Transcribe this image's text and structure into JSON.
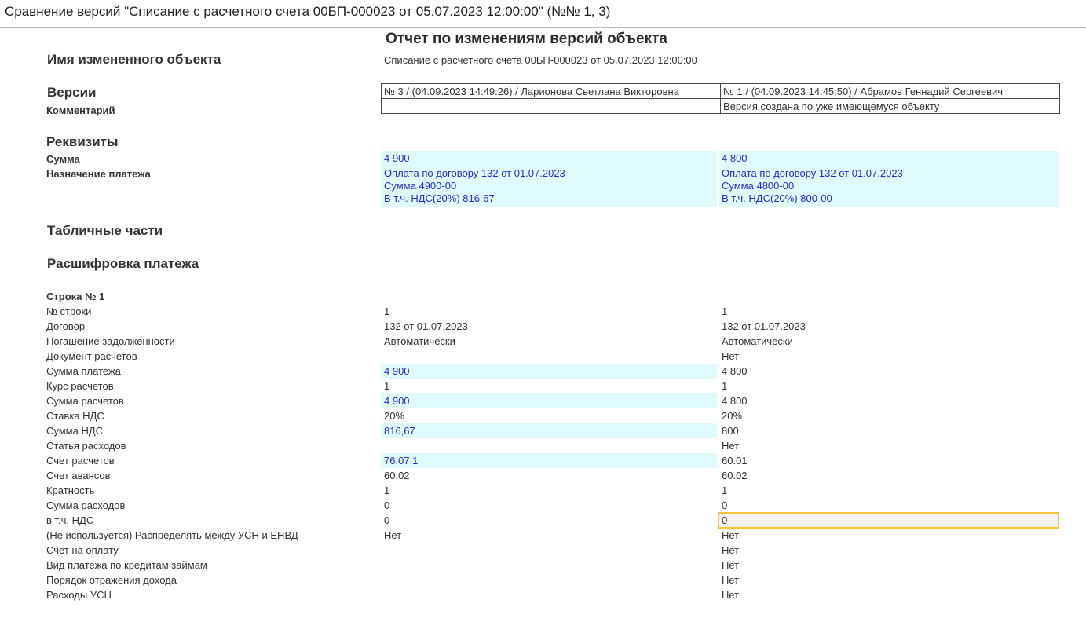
{
  "window": {
    "title": "Сравнение версий \"Списание с расчетного счета 00БП-000023 от 05.07.2023 12:00:00\" (№№ 1, 3)"
  },
  "report": {
    "title": "Отчет по изменениям версий объекта",
    "object_heading": "Имя измененного объекта",
    "object_name": "Списание с расчетного счета 00БП-000023 от 05.07.2023 12:00:00",
    "versions_heading": "Версии",
    "comment_label": "Комментарий",
    "versions": [
      {
        "header": "№ 3 / (04.09.2023 14:49:26) / Ларионова Светлана Викторовна",
        "comment": ""
      },
      {
        "header": "№ 1 / (04.09.2023 14:45:50) / Абрамов Геннадий Сергеевич",
        "comment": "Версия создана по уже имеющемуся объекту"
      }
    ],
    "attributes_heading": "Реквизиты",
    "attributes": {
      "sum_label": "Сумма",
      "sum_values": [
        "4 900",
        "4 800"
      ],
      "purpose_label": "Назначение платежа",
      "purpose_values": [
        [
          "Оплата по договору 132 от 01.07.2023",
          "Сумма 4900-00",
          "В т.ч. НДС(20%) 816-67"
        ],
        [
          "Оплата по договору 132 от 01.07.2023",
          "Сумма 4800-00",
          "В т.ч. НДС(20%) 800-00"
        ]
      ]
    },
    "tables_heading": "Табличные части",
    "table_name": "Расшифровка платежа",
    "row_heading": "Строка № 1",
    "rows": [
      {
        "label": "№ строки",
        "a": "1",
        "b": "1"
      },
      {
        "label": "Договор",
        "a": "132 от 01.07.2023",
        "b": "132 от 01.07.2023"
      },
      {
        "label": "Погашение задолженности",
        "a": "Автоматически",
        "b": "Автоматически"
      },
      {
        "label": "Документ расчетов",
        "a": "",
        "b": "Нет"
      },
      {
        "label": "Сумма платежа",
        "a": "4 900",
        "b": "4 800"
      },
      {
        "label": "Курс расчетов",
        "a": "1",
        "b": "1"
      },
      {
        "label": "Сумма расчетов",
        "a": "4 900",
        "b": "4 800"
      },
      {
        "label": "Ставка НДС",
        "a": "20%",
        "b": "20%"
      },
      {
        "label": "Сумма НДС",
        "a": "816,67",
        "b": "800"
      },
      {
        "label": "Статья расходов",
        "a": "",
        "b": "Нет"
      },
      {
        "label": "Счет расчетов",
        "a": "76.07.1",
        "b": "60.01"
      },
      {
        "label": "Счет авансов",
        "a": "60.02",
        "b": "60.02"
      },
      {
        "label": "Кратность",
        "a": "1",
        "b": "1"
      },
      {
        "label": "Сумма расходов",
        "a": "0",
        "b": "0"
      },
      {
        "label": "в т.ч. НДС",
        "a": "0",
        "b": "0"
      },
      {
        "label": "(Не используется) Распределять между УСН и ЕНВД",
        "a": "Нет",
        "b": "Нет"
      },
      {
        "label": "Счет на оплату",
        "a": "",
        "b": "Нет"
      },
      {
        "label": "Вид платежа по кредитам займам",
        "a": "",
        "b": "Нет"
      },
      {
        "label": "Порядок отражения дохода",
        "a": "",
        "b": "Нет"
      },
      {
        "label": "Расходы УСН",
        "a": "",
        "b": "Нет"
      }
    ]
  },
  "colors": {
    "changed_background": "#e0fbfd",
    "changed_text": "#1f2ed1",
    "selection_border": "#f5c342"
  }
}
